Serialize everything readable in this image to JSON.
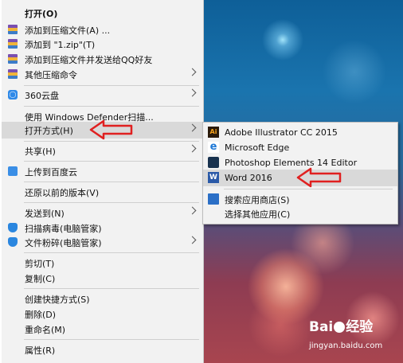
{
  "context_menu": {
    "items": [
      {
        "label": "打开(O)"
      },
      {
        "label": "添加到压缩文件(A) ..."
      },
      {
        "label": "添加到 \"1.zip\"(T)"
      },
      {
        "label": "添加到压缩文件并发送给QQ好友"
      },
      {
        "label": "其他压缩命令"
      },
      {
        "label": "360云盘"
      },
      {
        "label": "使用 Windows Defender扫描..."
      },
      {
        "label": "打开方式(H)"
      },
      {
        "label": "共享(H)"
      },
      {
        "label": "上传到百度云"
      },
      {
        "label": "还原以前的版本(V)"
      },
      {
        "label": "发送到(N)"
      },
      {
        "label": "扫描病毒(电脑管家)"
      },
      {
        "label": "文件粉碎(电脑管家)"
      },
      {
        "label": "剪切(T)"
      },
      {
        "label": "复制(C)"
      },
      {
        "label": "创建快捷方式(S)"
      },
      {
        "label": "删除(D)"
      },
      {
        "label": "重命名(M)"
      },
      {
        "label": "属性(R)"
      }
    ]
  },
  "open_with_submenu": {
    "items": [
      {
        "label": "Adobe Illustrator CC 2015",
        "icon": "illustrator-icon",
        "icon_text": "Ai"
      },
      {
        "label": "Microsoft Edge",
        "icon": "edge-icon",
        "icon_text": "e"
      },
      {
        "label": "Photoshop Elements 14 Editor",
        "icon": "photoshop-elements-icon"
      },
      {
        "label": "Word 2016",
        "icon": "word-icon",
        "icon_text": "W"
      },
      {
        "label": "搜索应用商店(S)",
        "icon": "store-icon"
      },
      {
        "label": "选择其他应用(C)"
      }
    ]
  },
  "watermark": {
    "logo_text_1": "Bai",
    "logo_text_2": "经验",
    "url": "jingyan.baidu.com"
  },
  "colors": {
    "menu_bg": "#f2f2f2",
    "highlight": "#d9d9d9",
    "annotation_arrow": "#e02020"
  }
}
